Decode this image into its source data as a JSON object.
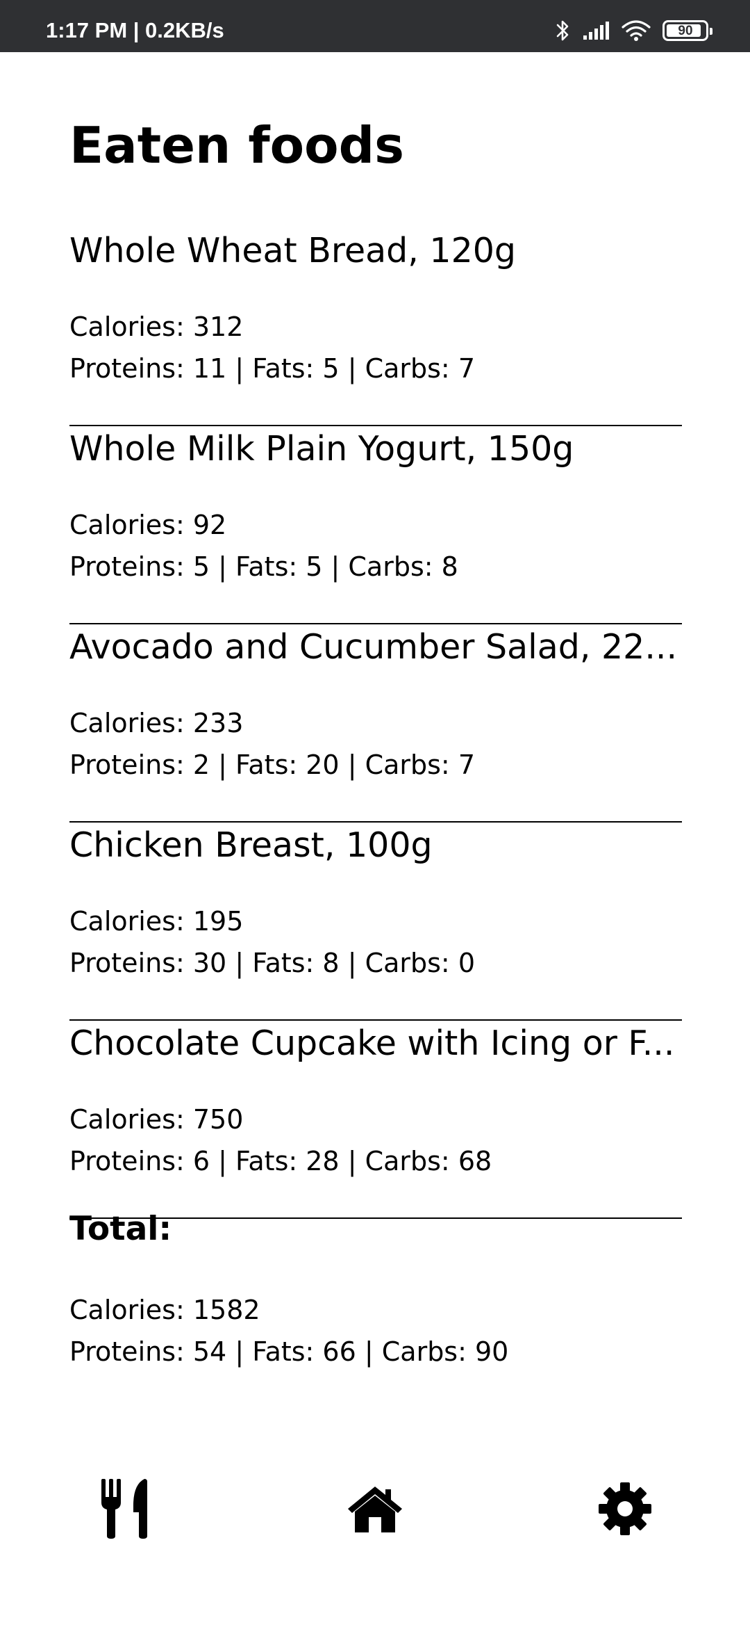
{
  "status_bar": {
    "time_speed": "1:17 PM | 0.2KB/s",
    "battery_level": "90",
    "battery_fraction": 0.9,
    "icons": [
      "bluetooth-icon",
      "signal-icon",
      "wifi-icon",
      "battery-icon"
    ]
  },
  "page": {
    "title": "Eaten foods"
  },
  "foods": [
    {
      "name": "Whole Wheat Bread, 120g",
      "calories": "Calories: 312",
      "macros": "Proteins: 11 | Fats: 5 | Carbs: 7"
    },
    {
      "name": "Whole Milk Plain Yogurt, 150g",
      "calories": "Calories: 92",
      "macros": "Proteins: 5 | Fats: 5 | Carbs: 8"
    },
    {
      "name": "Avocado and Cucumber Salad, 22...",
      "calories": "Calories: 233",
      "macros": "Proteins: 2 | Fats: 20 | Carbs: 7"
    },
    {
      "name": "Chicken Breast, 100g",
      "calories": "Calories: 195",
      "macros": "Proteins: 30 | Fats: 8 | Carbs: 0"
    },
    {
      "name": "Chocolate Cupcake with Icing or F...",
      "calories": "Calories: 750",
      "macros": "Proteins: 6 | Fats: 28 | Carbs: 68"
    }
  ],
  "total": {
    "label": "Total:",
    "calories": "Calories: 1582",
    "macros": "Proteins: 54 | Fats: 66 | Carbs: 90"
  },
  "bottom_nav": {
    "items": [
      "fork-knife-icon",
      "home-icon",
      "gear-icon"
    ]
  },
  "colors": {
    "status_bar_bg": "#2f3033",
    "text": "#000000",
    "background": "#ffffff"
  }
}
